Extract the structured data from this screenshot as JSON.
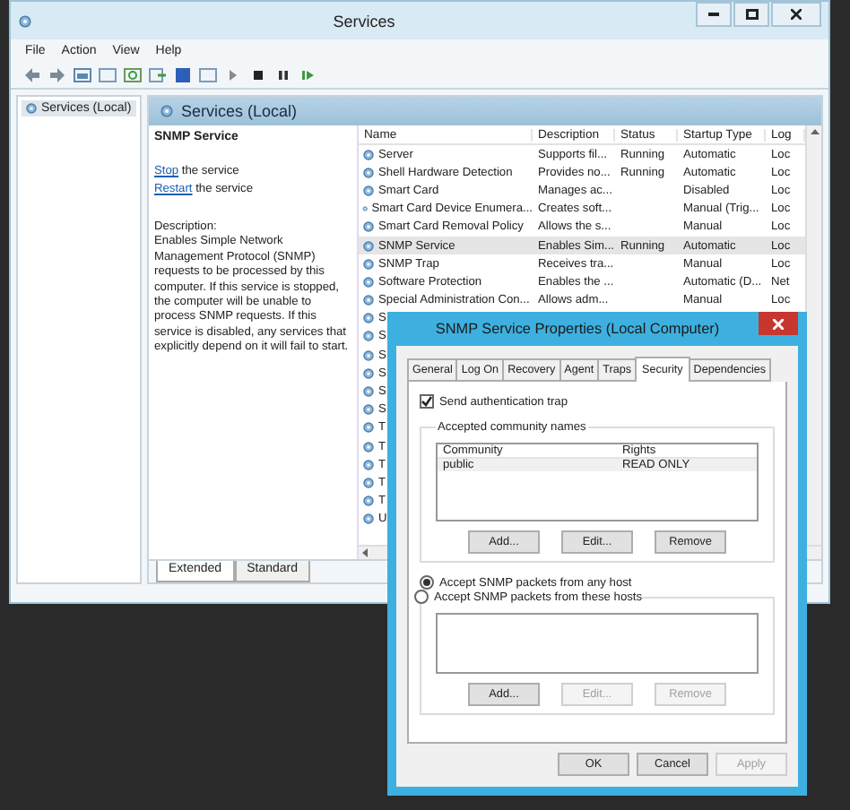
{
  "services_window": {
    "title": "Services",
    "menu": [
      "File",
      "Action",
      "View",
      "Help"
    ],
    "tree": [
      {
        "label": "Services (Local)",
        "selected": true
      }
    ],
    "header_title": "Services (Local)",
    "detail": {
      "name": "SNMP Service",
      "actions": [
        {
          "link": "Stop",
          "text": " the service"
        },
        {
          "link": "Restart",
          "text": " the service"
        }
      ],
      "description_label": "Description:",
      "description": "Enables Simple Network Management Protocol (SNMP) requests to be processed by this computer. If this service is stopped, the computer will be unable to process SNMP requests. If this service is disabled, any services that explicitly depend on it will fail to start."
    },
    "list": {
      "columns": [
        "Name",
        "Description",
        "Status",
        "Startup Type",
        "Log"
      ],
      "rows": [
        {
          "name": "Server",
          "description": "Supports fil...",
          "status": "Running",
          "startup_type": "Automatic",
          "log_on": "Loc",
          "selected": false
        },
        {
          "name": "Shell Hardware Detection",
          "description": "Provides no...",
          "status": "Running",
          "startup_type": "Automatic",
          "log_on": "Loc",
          "selected": false
        },
        {
          "name": "Smart Card",
          "description": "Manages ac...",
          "startup_type": "Disabled",
          "log_on": "Loc",
          "selected": false
        },
        {
          "name": "Smart Card Device Enumera...",
          "description": "Creates soft...",
          "startup_type": "Manual (Trig...",
          "log_on": "Loc",
          "selected": false
        },
        {
          "name": "Smart Card Removal Policy",
          "description": "Allows the s...",
          "startup_type": "Manual",
          "log_on": "Loc",
          "selected": false
        },
        {
          "name": "SNMP Service",
          "description": "Enables Sim...",
          "status": "Running",
          "startup_type": "Automatic",
          "log_on": "Loc",
          "selected": true
        },
        {
          "name": "SNMP Trap",
          "description": "Receives tra...",
          "startup_type": "Manual",
          "log_on": "Loc",
          "selected": false
        },
        {
          "name": "Software Protection",
          "description": "Enables the ...",
          "startup_type": "Automatic (D...",
          "log_on": "Net",
          "selected": false
        },
        {
          "name": "Special Administration Con...",
          "description": "Allows adm...",
          "startup_type": "Manual",
          "log_on": "Loc",
          "selected": false
        },
        {
          "name": "S",
          "selected": false
        },
        {
          "name": "S",
          "selected": false
        },
        {
          "name": "S",
          "selected": false
        },
        {
          "name": "S",
          "selected": false
        },
        {
          "name": "S",
          "selected": false
        },
        {
          "name": "S",
          "selected": false
        },
        {
          "name": "T",
          "selected": false
        },
        {
          "name": "T",
          "selected": false
        },
        {
          "name": "T",
          "selected": false
        },
        {
          "name": "T",
          "selected": false
        },
        {
          "name": "T",
          "selected": false
        },
        {
          "name": "U",
          "selected": false
        }
      ]
    },
    "view_tabs": [
      {
        "label": "Extended",
        "selected": true
      },
      {
        "label": "Standard",
        "selected": false
      }
    ]
  },
  "dialog": {
    "title": "SNMP Service Properties (Local Computer)",
    "tabs": [
      {
        "label": "General",
        "selected": false
      },
      {
        "label": "Log On",
        "selected": false
      },
      {
        "label": "Recovery",
        "selected": false
      },
      {
        "label": "Agent",
        "selected": false
      },
      {
        "label": "Traps",
        "selected": false
      },
      {
        "label": "Security",
        "selected": true
      },
      {
        "label": "Dependencies",
        "selected": false
      }
    ],
    "send_auth_trap": {
      "label": "Send authentication trap",
      "checked": true
    },
    "community_group": {
      "legend": "Accepted community names",
      "columns": [
        "Community",
        "Rights"
      ],
      "rows": [
        {
          "community": "public",
          "rights": "READ ONLY"
        }
      ],
      "buttons": [
        {
          "label": "Add...",
          "disabled": false
        },
        {
          "label": "Edit...",
          "disabled": false
        },
        {
          "label": "Remove",
          "disabled": false
        }
      ]
    },
    "host_options": [
      {
        "label": "Accept SNMP packets from any host",
        "selected": true
      },
      {
        "label": "Accept SNMP packets from these hosts",
        "selected": false
      }
    ],
    "hosts_buttons": [
      {
        "label": "Add...",
        "disabled": false
      },
      {
        "label": "Edit...",
        "disabled": true
      },
      {
        "label": "Remove",
        "disabled": true
      }
    ],
    "footer_buttons": [
      {
        "label": "OK",
        "disabled": false
      },
      {
        "label": "Cancel",
        "disabled": false
      },
      {
        "label": "Apply",
        "disabled": true
      }
    ]
  }
}
